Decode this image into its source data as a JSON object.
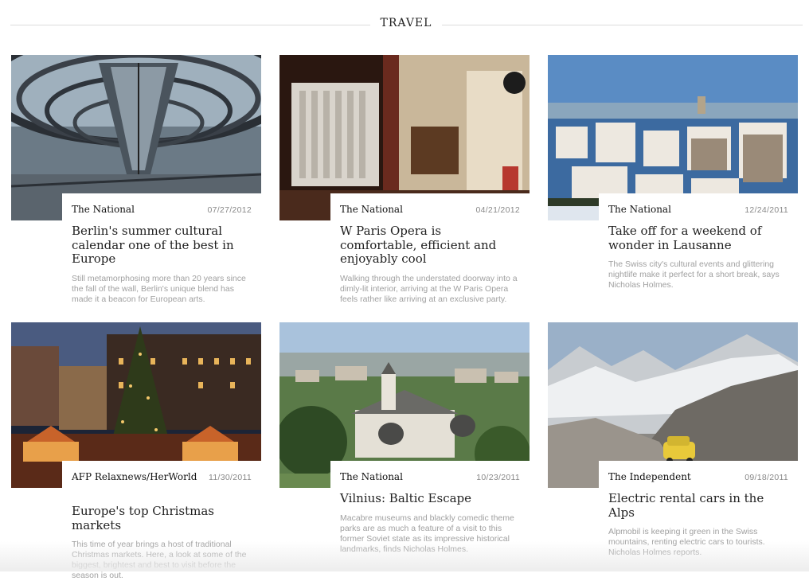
{
  "section": {
    "title": "TRAVEL"
  },
  "cards": [
    {
      "source": "The National",
      "date": "07/27/2012",
      "headline": "Berlin's summer cultural calendar one of the best in Europe",
      "blurb": "Still metamorphosing more than 20 years since the fall of the wall, Berlin's unique blend has made it a beacon for European arts."
    },
    {
      "source": "The National",
      "date": "04/21/2012",
      "headline": "W Paris Opera is comfortable, efficient and enjoyably cool",
      "blurb": "Walking through the understated doorway into a dimly-lit interior, arriving at the W Paris Opera feels rather like arriving at an exclusive party."
    },
    {
      "source": "The National",
      "date": "12/24/2011",
      "headline": "Take off for a weekend of wonder in Lausanne",
      "blurb": "The Swiss city's cultural events and glittering nightlife make it perfect for a short break, says Nicholas Holmes."
    },
    {
      "source": "AFP Relaxnews/HerWorld",
      "date": "11/30/2011",
      "headline": "Europe's top Christmas markets",
      "blurb": "This time of year brings a host of traditional Christmas markets. Here, a look at some of the biggest, brightest and best to visit before the season is out."
    },
    {
      "source": "The National",
      "date": "10/23/2011",
      "headline": "Vilnius: Baltic Escape",
      "blurb": "Macabre museums and blackly comedic theme parks are as much a feature of a visit to this former Soviet state as its impressive historical landmarks, finds Nicholas Holmes."
    },
    {
      "source": "The Independent",
      "date": "09/18/2011",
      "headline": "Electric rental cars in the Alps",
      "blurb": "Alpmobil is keeping it green in the Swiss mountains, renting electric cars to tourists. Nicholas Holmes reports."
    }
  ]
}
